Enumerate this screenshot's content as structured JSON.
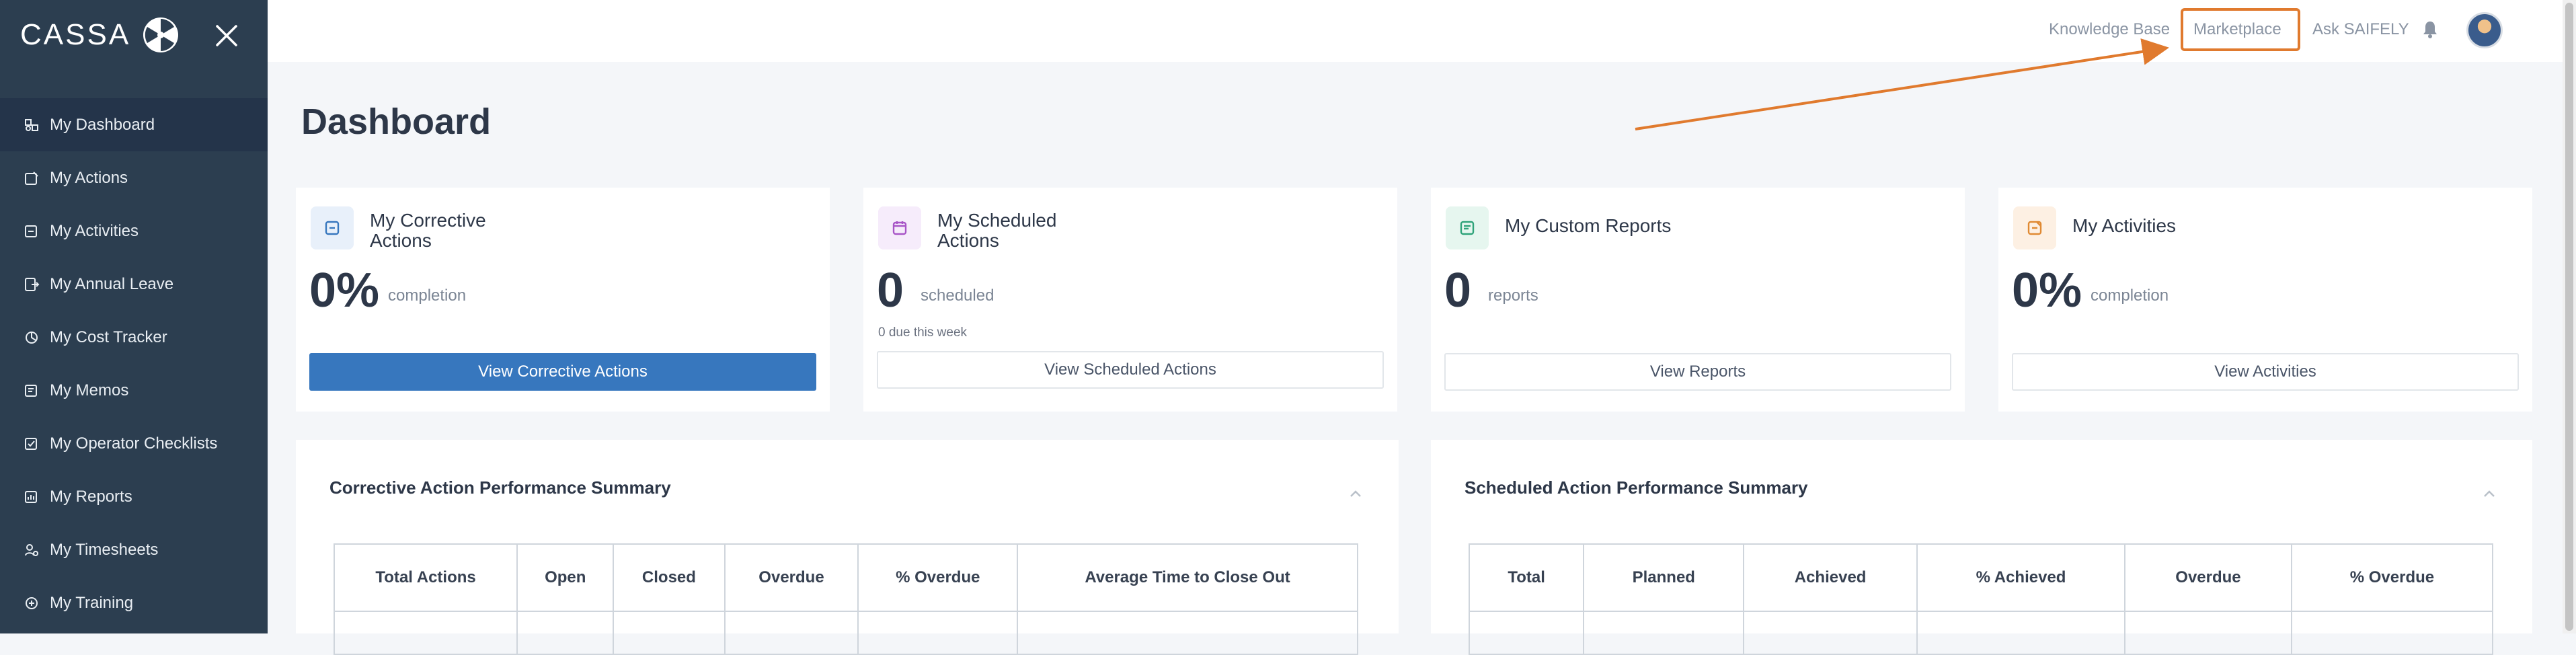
{
  "brand": {
    "name": "CASSA"
  },
  "sidebar": {
    "items": [
      {
        "label": "My Dashboard",
        "icon": "dashboard-icon",
        "active": true
      },
      {
        "label": "My Actions",
        "icon": "actions-icon"
      },
      {
        "label": "My Activities",
        "icon": "activities-icon"
      },
      {
        "label": "My Annual Leave",
        "icon": "annual-leave-icon"
      },
      {
        "label": "My Cost Tracker",
        "icon": "cost-tracker-icon"
      },
      {
        "label": "My Memos",
        "icon": "memos-icon"
      },
      {
        "label": "My Operator Checklists",
        "icon": "checklist-icon"
      },
      {
        "label": "My Reports",
        "icon": "reports-icon"
      },
      {
        "label": "My Timesheets",
        "icon": "timesheets-icon"
      },
      {
        "label": "My Training",
        "icon": "training-icon"
      }
    ]
  },
  "topbar": {
    "knowledge_base": "Knowledge Base",
    "marketplace": "Marketplace",
    "ask": "Ask SAIFELY"
  },
  "page": {
    "title": "Dashboard"
  },
  "cards": {
    "corrective": {
      "title": "My Corrective Actions",
      "value": "0%",
      "unit": "completion",
      "button": "View Corrective Actions"
    },
    "scheduled": {
      "title": "My Scheduled Actions",
      "value": "0",
      "unit": "scheduled",
      "sub": "0 due this week",
      "button": "View Scheduled Actions"
    },
    "custom": {
      "title": "My Custom Reports",
      "value": "0",
      "unit": "reports",
      "button": "View Reports"
    },
    "activities": {
      "title": "My Activities",
      "value": "0%",
      "unit": "completion",
      "button": "View Activities"
    }
  },
  "panels": {
    "corrective": {
      "title": "Corrective Action Performance Summary",
      "columns": [
        "Total Actions",
        "Open",
        "Closed",
        "Overdue",
        "% Overdue",
        "Average Time to Close Out"
      ]
    },
    "scheduled": {
      "title": "Scheduled Action Performance Summary",
      "columns": [
        "Total",
        "Planned",
        "Achieved",
        "% Achieved",
        "Overdue",
        "% Overdue"
      ]
    }
  },
  "colors": {
    "sidebar": "#2c3e50",
    "primary_button": "#3777be",
    "highlight": "#e07a2e"
  }
}
